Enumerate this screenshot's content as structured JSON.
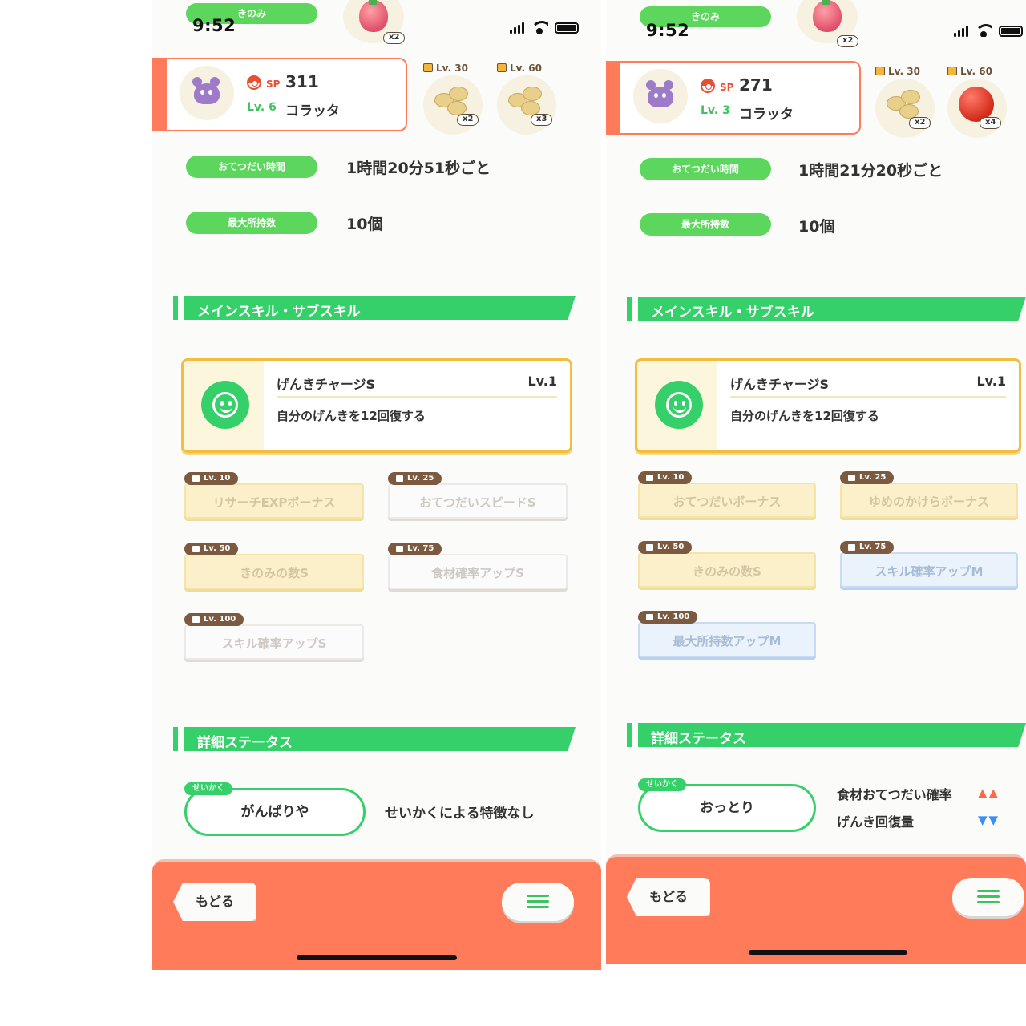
{
  "colors": {
    "green": "#35d06a",
    "coral": "#ff7b5a",
    "gold": "#f3be3f"
  },
  "left": {
    "status": {
      "time": "9:52",
      "berry_label": "きのみ",
      "berry_qty": "x2"
    },
    "pokemon": {
      "sp_label": "SP",
      "sp": "311",
      "lv": "Lv. 6",
      "name": "コラッタ"
    },
    "unlocks": [
      {
        "lv": "Lv. 30",
        "qty": "x2",
        "icon": "potato-icon"
      },
      {
        "lv": "Lv. 60",
        "qty": "x3",
        "icon": "potato-icon"
      }
    ],
    "help_time_label": "おてつだい時間",
    "help_time_value": "1時間20分51秒ごと",
    "max_carry_label": "最大所持数",
    "max_carry_value": "10個",
    "skills_title": "メインスキル・サブスキル",
    "main_skill": {
      "name": "げんきチャージS",
      "lv": "Lv.1",
      "desc": "自分のげんきを12回復する",
      "icon": "smile-icon"
    },
    "sub_skills": [
      {
        "lv": "Lv. 10",
        "name": "リサーチEXPボーナス"
      },
      {
        "lv": "Lv. 25",
        "name": "おてつだいスピードS"
      },
      {
        "lv": "Lv. 50",
        "name": "きのみの数S"
      },
      {
        "lv": "Lv. 75",
        "name": "食材確率アップS"
      },
      {
        "lv": "Lv. 100",
        "name": "スキル確率アップS"
      }
    ],
    "detail_title": "詳細ステータス",
    "nature": {
      "tag": "せいかく",
      "name": "がんばりや",
      "effect": "せいかくによる特徴なし"
    },
    "back_label": "もどる"
  },
  "right": {
    "status": {
      "time": "9:52",
      "berry_label": "きのみ",
      "berry_qty": "x2"
    },
    "pokemon": {
      "sp_label": "SP",
      "sp": "271",
      "lv": "Lv. 3",
      "name": "コラッタ"
    },
    "unlocks": [
      {
        "lv": "Lv. 30",
        "qty": "x2",
        "icon": "potato-icon"
      },
      {
        "lv": "Lv. 60",
        "qty": "x4",
        "icon": "apple-icon"
      }
    ],
    "help_time_label": "おてつだい時間",
    "help_time_value": "1時間21分20秒ごと",
    "max_carry_label": "最大所持数",
    "max_carry_value": "10個",
    "skills_title": "メインスキル・サブスキル",
    "main_skill": {
      "name": "げんきチャージS",
      "lv": "Lv.1",
      "desc": "自分のげんきを12回復する",
      "icon": "smile-icon"
    },
    "sub_skills": [
      {
        "lv": "Lv. 10",
        "name": "おてつだいボーナス"
      },
      {
        "lv": "Lv. 25",
        "name": "ゆめのかけらボーナス"
      },
      {
        "lv": "Lv. 50",
        "name": "きのみの数S"
      },
      {
        "lv": "Lv. 75",
        "name": "スキル確率アップM"
      },
      {
        "lv": "Lv. 100",
        "name": "最大所持数アップM"
      }
    ],
    "detail_title": "詳細ステータス",
    "nature": {
      "tag": "せいかく",
      "name": "おっとり",
      "effects": [
        {
          "label": "食材おてつだい確率",
          "arrows": "▲▲"
        },
        {
          "label": "げんき回復量",
          "arrows": "▼▼"
        }
      ]
    },
    "back_label": "もどる"
  }
}
